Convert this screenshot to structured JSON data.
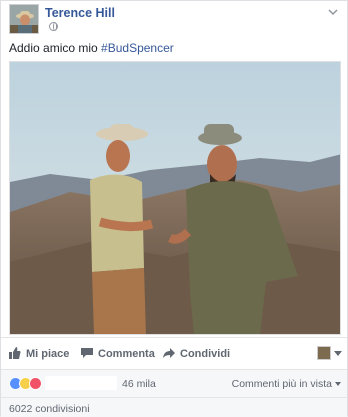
{
  "post": {
    "author": "Terence Hill",
    "text_prefix": "Addio amico mio ",
    "hashtag": "#BudSpencer"
  },
  "actions": {
    "like": "Mi piace",
    "comment": "Commenta",
    "share": "Condividi"
  },
  "reactions": {
    "count": "46 mila",
    "comments_filter": "Commenti più in vista"
  },
  "shares": {
    "text": "6022 condivisioni"
  },
  "colors": {
    "link_blue": "#365899",
    "like_blue": "#5890ff",
    "love_red": "#f25268",
    "sad_yellow": "#f7d04b"
  }
}
